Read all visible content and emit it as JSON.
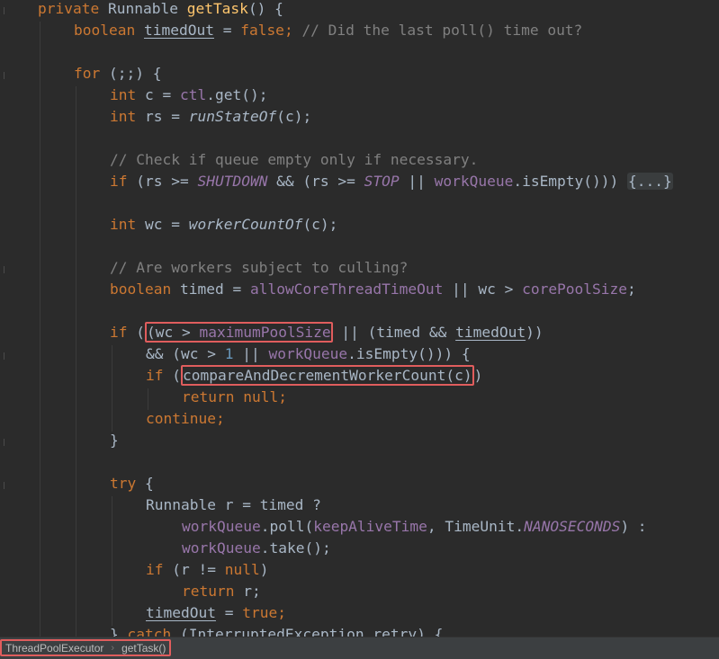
{
  "code": {
    "method_sig": {
      "kw1": "private",
      "type": "Runnable",
      "name": "getTask",
      "rest": "() {"
    },
    "l2": {
      "kw": "boolean",
      "var": "timedOut",
      "rest": " = ",
      "val": "false",
      "semi": ";",
      "comment": "// Did the last poll() time out?"
    },
    "l4": {
      "kw": "for",
      "rest": " (;;) {"
    },
    "l5": {
      "kw": "int",
      "a": " c = ",
      "fld": "ctl",
      "b": ".get();"
    },
    "l6": {
      "kw": "int",
      "a": " rs = ",
      "fn": "runStateOf",
      "b": "(c);"
    },
    "l8": {
      "comment": "// Check if queue empty only if necessary."
    },
    "l9": {
      "kw": "if",
      "a": " (rs >= ",
      "c1": "SHUTDOWN",
      "b": " && (rs >= ",
      "c2": "STOP",
      "c": " || ",
      "fld": "workQueue",
      "d": ".isEmpty())) ",
      "fold": "{...}"
    },
    "l11": {
      "kw": "int",
      "a": " wc = ",
      "fn": "workerCountOf",
      "b": "(c);"
    },
    "l13": {
      "comment": "// Are workers subject to culling?"
    },
    "l14": {
      "kw": "boolean",
      "a": " timed = ",
      "fld1": "allowCoreThreadTimeOut",
      "b": " || wc > ",
      "fld2": "corePoolSize",
      "c": ";"
    },
    "l16": {
      "kw": "if",
      "a": " (",
      "boxed_a": "(wc > ",
      "boxed_fld": "maximumPoolSize",
      "b": " || (timed && ",
      "var": "timedOut",
      "c": "))"
    },
    "l17": {
      "a": "&& (wc > ",
      "num": "1",
      "b": " || ",
      "fld": "workQueue",
      "c": ".isEmpty())) {"
    },
    "l18": {
      "kw": "if",
      "a": " (",
      "boxed": "compareAndDecrementWorkerCount(c)",
      "b": ")"
    },
    "l19": {
      "kw": "return",
      "a": " ",
      "val": "null",
      "b": ";"
    },
    "l20": {
      "kw": "continue",
      "a": ";"
    },
    "l21": {
      "a": "}"
    },
    "l23": {
      "kw": "try",
      "a": " {"
    },
    "l24": {
      "a": "Runnable r = timed ?"
    },
    "l25": {
      "fld": "workQueue",
      "a": ".poll(",
      "fld2": "keepAliveTime",
      "b": ", TimeUnit.",
      "c": "NANOSECONDS",
      "d": ") :"
    },
    "l26": {
      "fld": "workQueue",
      "a": ".take();"
    },
    "l27": {
      "kw": "if",
      "a": " (r != ",
      "val": "null",
      "b": ")"
    },
    "l28": {
      "kw": "return",
      "a": " r;"
    },
    "l29": {
      "var": "timedOut",
      "a": " = ",
      "val": "true",
      "b": ";"
    },
    "l30": {
      "a": "} ",
      "kw": "catch",
      "b": " (InterruptedException retry) {"
    }
  },
  "status_bar": {
    "breadcrumb": [
      "ThreadPoolExecutor",
      "getTask()"
    ],
    "separator": "›"
  },
  "colors": {
    "background": "#2b2b2b",
    "keyword": "#cc7832",
    "method": "#ffc66d",
    "field": "#9876aa",
    "comment": "#808080",
    "number": "#6897bb",
    "highlight_box": "#e05d5d"
  }
}
